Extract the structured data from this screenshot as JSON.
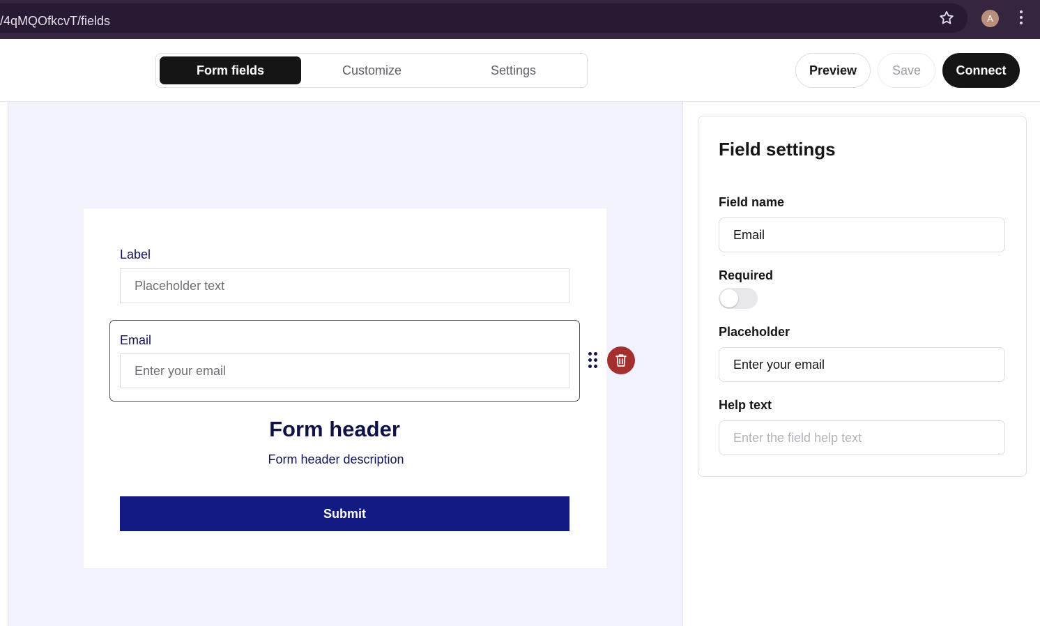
{
  "browser": {
    "url": "/4qMQOfkcvT/fields",
    "avatar_letter": "A"
  },
  "header": {
    "tabs": [
      {
        "label": "Form fields",
        "active": true
      },
      {
        "label": "Customize",
        "active": false
      },
      {
        "label": "Settings",
        "active": false
      }
    ],
    "preview_label": "Preview",
    "save_label": "Save",
    "connect_label": "Connect"
  },
  "form": {
    "fields": [
      {
        "label": "Label",
        "placeholder": "Placeholder text"
      },
      {
        "label": "Email",
        "placeholder": "Enter your email",
        "selected": true
      }
    ],
    "header_title": "Form header",
    "header_description": "Form header description",
    "submit_label": "Submit"
  },
  "field_settings": {
    "title": "Field settings",
    "field_name_label": "Field name",
    "field_name_value": "Email",
    "required_label": "Required",
    "required_on": false,
    "placeholder_label": "Placeholder",
    "placeholder_value": "Enter your email",
    "help_text_label": "Help text",
    "help_text_placeholder": "Enter the field help text"
  },
  "colors": {
    "browser_bar": "#35253f",
    "primary_dark": "#151515",
    "form_text": "#101454",
    "submit_bg": "#131a82",
    "delete_bg": "#a42f2f",
    "canvas_bg": "#f2f2fd"
  }
}
